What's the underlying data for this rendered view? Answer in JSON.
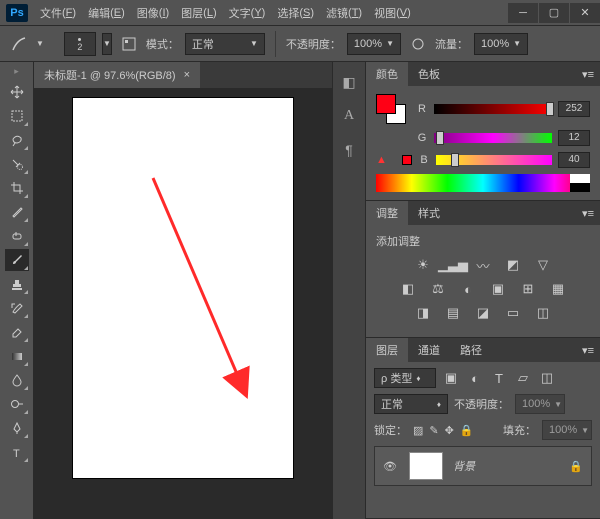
{
  "app": {
    "logo": "Ps"
  },
  "menu": [
    {
      "label": "文件",
      "key": "F"
    },
    {
      "label": "编辑",
      "key": "E"
    },
    {
      "label": "图像",
      "key": "I"
    },
    {
      "label": "图层",
      "key": "L"
    },
    {
      "label": "文字",
      "key": "Y"
    },
    {
      "label": "选择",
      "key": "S"
    },
    {
      "label": "滤镜",
      "key": "T"
    },
    {
      "label": "视图",
      "key": "V"
    }
  ],
  "options": {
    "brush_size": "2",
    "mode_label": "模式：",
    "mode_value": "正常",
    "opacity_label": "不透明度：",
    "opacity_value": "100%",
    "flow_label": "流量：",
    "flow_value": "100%"
  },
  "document": {
    "tab_title": "未标题-1 @ 97.6%(RGB/8)"
  },
  "panels": {
    "color": {
      "tab_color": "颜色",
      "tab_swatches": "色板",
      "r_label": "R",
      "r_value": "252",
      "g_label": "G",
      "g_value": "12",
      "b_label": "B",
      "b_value": "40"
    },
    "adjustments": {
      "tab_adjust": "调整",
      "tab_styles": "样式",
      "title": "添加调整"
    },
    "layers": {
      "tab_layers": "图层",
      "tab_channels": "通道",
      "tab_paths": "路径",
      "kind_label": "ρ 类型",
      "blend_mode": "正常",
      "opacity_label": "不透明度：",
      "opacity_value": "100%",
      "lock_label": "锁定：",
      "fill_label": "填充：",
      "fill_value": "100%",
      "layer_name": "背景"
    }
  }
}
